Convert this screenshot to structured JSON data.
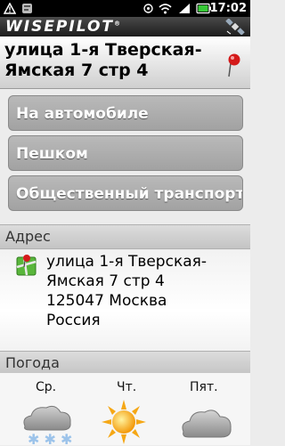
{
  "status_bar": {
    "time": "17:02"
  },
  "app": {
    "brand": "WISEPILOT",
    "registered_mark": "®"
  },
  "header": {
    "title": "улица 1-я Тверская-Ямская 7 стр 4"
  },
  "route_options": [
    {
      "label": "На автомобиле"
    },
    {
      "label": "Пешком"
    },
    {
      "label": "Общественный транспорт"
    }
  ],
  "address_section": {
    "heading": "Адрес",
    "line1": "улица 1-я Тверская-",
    "line2": "Ямская 7 стр 4",
    "line3": "125047 Москва",
    "line4": "Россия"
  },
  "weather_section": {
    "heading": "Погода",
    "days": [
      {
        "label": "Ср.",
        "icon": "snow-cloud-icon"
      },
      {
        "label": "Чт.",
        "icon": "sun-icon"
      },
      {
        "label": "Пят.",
        "icon": "cloud-icon"
      }
    ]
  }
}
